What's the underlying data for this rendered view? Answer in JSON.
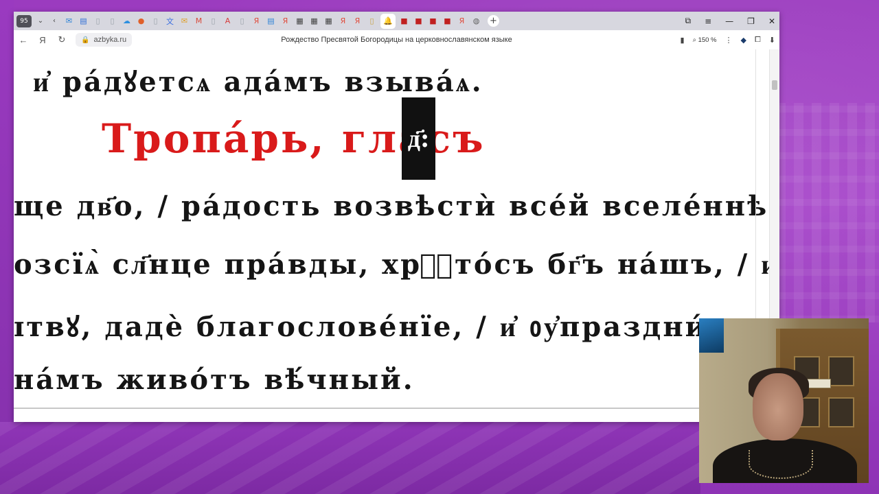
{
  "browser": {
    "tab_counter": "95",
    "url_host": "azbyka.ru",
    "page_title": "Рождество Пресвятой Богородицы на церковнославянском языке",
    "zoom": "150 %",
    "tabs": [
      {
        "icon": "mail-icon",
        "color": "#2f83d6"
      },
      {
        "icon": "doc-icon",
        "color": "#2f6fd6"
      },
      {
        "icon": "page-icon",
        "color": "#9aa0a8"
      },
      {
        "icon": "page-icon",
        "color": "#9aa0a8"
      },
      {
        "icon": "cloud-icon",
        "color": "#2c8fe0"
      },
      {
        "icon": "firefox-icon",
        "color": "#e0602a"
      },
      {
        "icon": "page-icon",
        "color": "#9aa0a8"
      },
      {
        "icon": "translate-icon",
        "color": "#3a6ee0"
      },
      {
        "icon": "mail-icon",
        "color": "#e0a02a"
      },
      {
        "icon": "gmail-icon",
        "color": "#d94a3a"
      },
      {
        "icon": "page-icon",
        "color": "#9aa0a8"
      },
      {
        "icon": "pdf-icon",
        "color": "#d63b3b"
      },
      {
        "icon": "page-icon",
        "color": "#9aa0a8"
      },
      {
        "icon": "yandex-icon",
        "color": "#e04a3a"
      },
      {
        "icon": "doc-icon",
        "color": "#2f83d6"
      },
      {
        "icon": "yandex-icon",
        "color": "#e04a3a"
      },
      {
        "icon": "calendar-icon",
        "color": "#404040"
      },
      {
        "icon": "calendar-icon",
        "color": "#404040"
      },
      {
        "icon": "calendar-icon",
        "color": "#404040"
      },
      {
        "icon": "yandex-icon",
        "color": "#e04a3a"
      },
      {
        "icon": "yandex-icon",
        "color": "#e04a3a"
      },
      {
        "icon": "page-icon",
        "color": "#c8a040"
      },
      {
        "icon": "bell-icon",
        "color": "#d92020",
        "active": true
      },
      {
        "icon": "red-square-icon",
        "color": "#c02020"
      },
      {
        "icon": "red-square-icon",
        "color": "#c02020"
      },
      {
        "icon": "red-square-icon",
        "color": "#c02020"
      },
      {
        "icon": "red-square-icon",
        "color": "#c02020"
      },
      {
        "icon": "yandex-icon",
        "color": "#e04a3a"
      },
      {
        "icon": "globe-icon",
        "color": "#606060"
      }
    ]
  },
  "text": {
    "line1": "и҆ ра́дꙋетсѧ ада́мъ взыва́ѧ.",
    "troparion_title": "Тропа́рь, гла́съ",
    "tone": "д҃:",
    "line3": "ще дв҃о, / ра́дость возвѣстѝ все́й вселе́ннѣй: /",
    "line4": "озсїѧ̀ сл҃нце пра́вды, хрⷭ҇то́съ бг҃ъ на́шъ, / и҆",
    "line5": "ɪтвꙋ, дадѐ благослове́нїе, / и҆ ᲂу҆праздни́въ",
    "line6": "на́мъ живо́тъ вѣ́чный."
  },
  "colors": {
    "title_red": "#d91a1a",
    "background_purple": "#a441c8"
  }
}
